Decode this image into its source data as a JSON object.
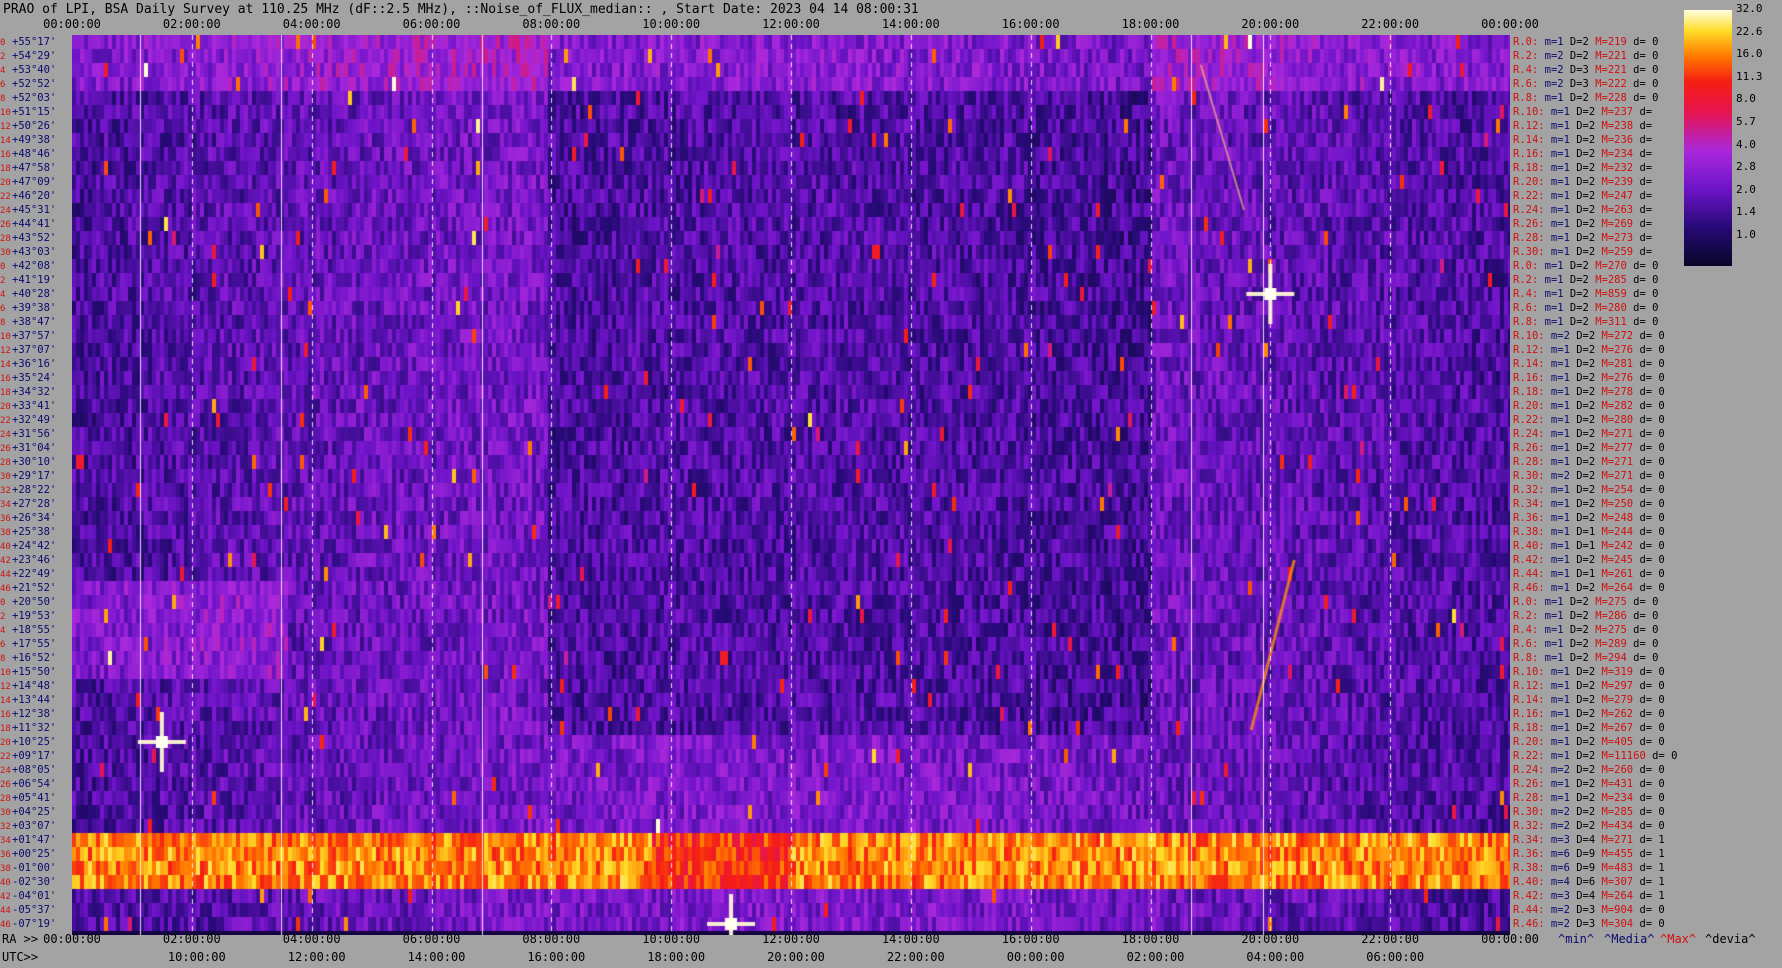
{
  "title": "PRAO of LPI, BSA Daily Survey at 110.25 MHz (dF::2.5 MHz), ::Noise_of_FLUX_median:: , Start Date: 2023 04 14 08:00:31",
  "top_axis_ticks": [
    "00:00:00",
    "02:00:00",
    "04:00:00",
    "06:00:00",
    "08:00:00",
    "10:00:00",
    "12:00:00",
    "14:00:00",
    "16:00:00",
    "18:00:00",
    "20:00:00",
    "22:00:00",
    "00:00:00"
  ],
  "bottom_ra_label": "RA >>",
  "bottom_utc_label": "UTC>>",
  "bottom_ra_ticks": [
    "00:00:00",
    "02:00:00",
    "04:00:00",
    "06:00:00",
    "08:00:00",
    "10:00:00",
    "12:00:00",
    "14:00:00",
    "16:00:00",
    "18:00:00",
    "20:00:00",
    "22:00:00",
    "00:00:00"
  ],
  "bottom_utc_ticks": [
    "10:00:00",
    "12:00:00",
    "14:00:00",
    "16:00:00",
    "18:00:00",
    "20:00:00",
    "22:00:00",
    "00:00:00",
    "02:00:00",
    "04:00:00",
    "06:00:00"
  ],
  "legend": {
    "min": "^min^",
    "median": "^Media^",
    "max": "^Max^",
    "devia": "^devia^"
  },
  "colorbar": {
    "ticks": [
      "32.0",
      "22.6",
      "16.0",
      "11.3",
      "8.0",
      "5.7",
      "4.0",
      "2.8",
      "2.0",
      "1.4",
      "1.0"
    ]
  },
  "colors": {
    "background": "#a3a3a3",
    "index_label": "#d01010",
    "declination_label": "#0a0a70",
    "max_label": "#d01010"
  },
  "chart_data": {
    "type": "heatmap",
    "title": "PRAO of LPI, BSA Daily Survey at 110.25 MHz (dF::2.5 MHz), ::Noise_of_FLUX_median:: , Start Date: 2023 04 14 08:00:31",
    "x_unit": "RA (hh:mm:ss)",
    "xlim": [
      "00:00:00",
      "24:00:00"
    ],
    "y_unit": "declination",
    "color_scale": "log",
    "zlim": [
      1.0,
      32.0
    ],
    "rows": [
      {
        "idx": "0",
        "dec": "+55°17'",
        "stat": {
          "r": "R.0:",
          "m": "m=1",
          "d": "D=2",
          "max": "M=219",
          "dev": "d= 0"
        }
      },
      {
        "idx": "2",
        "dec": "+54°29'",
        "stat": {
          "r": "R.2:",
          "m": "m=2",
          "d": "D=2",
          "max": "M=221",
          "dev": "d= 0"
        }
      },
      {
        "idx": "4",
        "dec": "+53°40'",
        "stat": {
          "r": "R.4:",
          "m": "m=2",
          "d": "D=3",
          "max": "M=221",
          "dev": "d= 0"
        }
      },
      {
        "idx": "6",
        "dec": "+52°52'",
        "stat": {
          "r": "R.6:",
          "m": "m=2",
          "d": "D=3",
          "max": "M=222",
          "dev": "d= 0"
        }
      },
      {
        "idx": "8",
        "dec": "+52°03'",
        "stat": {
          "r": "R.8:",
          "m": "m=1",
          "d": "D=2",
          "max": "M=228",
          "dev": "d= 0"
        }
      },
      {
        "idx": "10",
        "dec": "+51°15'",
        "stat": {
          "r": "R.10:",
          "m": "m=1",
          "d": "D=2",
          "max": "M=237",
          "dev": "d="
        }
      },
      {
        "idx": "12",
        "dec": "+50°26'",
        "stat": {
          "r": "R.12:",
          "m": "m=1",
          "d": "D=2",
          "max": "M=238",
          "dev": "d="
        }
      },
      {
        "idx": "14",
        "dec": "+49°38'",
        "stat": {
          "r": "R.14:",
          "m": "m=1",
          "d": "D=2",
          "max": "M=236",
          "dev": "d="
        }
      },
      {
        "idx": "16",
        "dec": "+48°46'",
        "stat": {
          "r": "R.16:",
          "m": "m=1",
          "d": "D=2",
          "max": "M=234",
          "dev": "d="
        }
      },
      {
        "idx": "18",
        "dec": "+47°58'",
        "stat": {
          "r": "R.18:",
          "m": "m=1",
          "d": "D=2",
          "max": "M=232",
          "dev": "d="
        }
      },
      {
        "idx": "20",
        "dec": "+47°09'",
        "stat": {
          "r": "R.20:",
          "m": "m=1",
          "d": "D=2",
          "max": "M=239",
          "dev": "d="
        }
      },
      {
        "idx": "22",
        "dec": "+46°20'",
        "stat": {
          "r": "R.22:",
          "m": "m=1",
          "d": "D=2",
          "max": "M=247",
          "dev": "d="
        }
      },
      {
        "idx": "24",
        "dec": "+45°31'",
        "stat": {
          "r": "R.24:",
          "m": "m=1",
          "d": "D=2",
          "max": "M=263",
          "dev": "d="
        }
      },
      {
        "idx": "26",
        "dec": "+44°41'",
        "stat": {
          "r": "R.26:",
          "m": "m=1",
          "d": "D=2",
          "max": "M=269",
          "dev": "d="
        }
      },
      {
        "idx": "28",
        "dec": "+43°52'",
        "stat": {
          "r": "R.28:",
          "m": "m=1",
          "d": "D=2",
          "max": "M=273",
          "dev": "d="
        }
      },
      {
        "idx": "30",
        "dec": "+43°03'",
        "stat": {
          "r": "R.30:",
          "m": "m=1",
          "d": "D=2",
          "max": "M=259",
          "dev": "d="
        }
      },
      {
        "idx": "0",
        "dec": "+42°08'",
        "stat": {
          "r": "R.0:",
          "m": "m=1",
          "d": "D=2",
          "max": "M=270",
          "dev": "d= 0"
        }
      },
      {
        "idx": "2",
        "dec": "+41°19'",
        "stat": {
          "r": "R.2:",
          "m": "m=1",
          "d": "D=2",
          "max": "M=285",
          "dev": "d= 0"
        }
      },
      {
        "idx": "4",
        "dec": "+40°28'",
        "stat": {
          "r": "R.4:",
          "m": "m=1",
          "d": "D=2",
          "max": "M=859",
          "dev": "d= 0"
        }
      },
      {
        "idx": "6",
        "dec": "+39°38'",
        "stat": {
          "r": "R.6:",
          "m": "m=1",
          "d": "D=2",
          "max": "M=280",
          "dev": "d= 0"
        }
      },
      {
        "idx": "8",
        "dec": "+38°47'",
        "stat": {
          "r": "R.8:",
          "m": "m=1",
          "d": "D=2",
          "max": "M=311",
          "dev": "d= 0"
        }
      },
      {
        "idx": "10",
        "dec": "+37°57'",
        "stat": {
          "r": "R.10:",
          "m": "m=2",
          "d": "D=2",
          "max": "M=272",
          "dev": "d= 0"
        }
      },
      {
        "idx": "12",
        "dec": "+37°07'",
        "stat": {
          "r": "R.12:",
          "m": "m=1",
          "d": "D=2",
          "max": "M=276",
          "dev": "d= 0"
        }
      },
      {
        "idx": "14",
        "dec": "+36°16'",
        "stat": {
          "r": "R.14:",
          "m": "m=1",
          "d": "D=2",
          "max": "M=281",
          "dev": "d= 0"
        }
      },
      {
        "idx": "16",
        "dec": "+35°24'",
        "stat": {
          "r": "R.16:",
          "m": "m=1",
          "d": "D=2",
          "max": "M=276",
          "dev": "d= 0"
        }
      },
      {
        "idx": "18",
        "dec": "+34°32'",
        "stat": {
          "r": "R.18:",
          "m": "m=1",
          "d": "D=2",
          "max": "M=278",
          "dev": "d= 0"
        }
      },
      {
        "idx": "20",
        "dec": "+33°41'",
        "stat": {
          "r": "R.20:",
          "m": "m=1",
          "d": "D=2",
          "max": "M=282",
          "dev": "d= 0"
        }
      },
      {
        "idx": "22",
        "dec": "+32°49'",
        "stat": {
          "r": "R.22:",
          "m": "m=1",
          "d": "D=2",
          "max": "M=280",
          "dev": "d= 0"
        }
      },
      {
        "idx": "24",
        "dec": "+31°56'",
        "stat": {
          "r": "R.24:",
          "m": "m=1",
          "d": "D=2",
          "max": "M=271",
          "dev": "d= 0"
        }
      },
      {
        "idx": "26",
        "dec": "+31°04'",
        "stat": {
          "r": "R.26:",
          "m": "m=1",
          "d": "D=2",
          "max": "M=277",
          "dev": "d= 0"
        }
      },
      {
        "idx": "28",
        "dec": "+30°10'",
        "stat": {
          "r": "R.28:",
          "m": "m=1",
          "d": "D=2",
          "max": "M=271",
          "dev": "d= 0"
        }
      },
      {
        "idx": "30",
        "dec": "+29°17'",
        "stat": {
          "r": "R.30:",
          "m": "m=2",
          "d": "D=2",
          "max": "M=271",
          "dev": "d= 0"
        }
      },
      {
        "idx": "32",
        "dec": "+28°22'",
        "stat": {
          "r": "R.32:",
          "m": "m=1",
          "d": "D=2",
          "max": "M=254",
          "dev": "d= 0"
        }
      },
      {
        "idx": "34",
        "dec": "+27°28'",
        "stat": {
          "r": "R.34:",
          "m": "m=1",
          "d": "D=2",
          "max": "M=250",
          "dev": "d= 0"
        }
      },
      {
        "idx": "36",
        "dec": "+26°34'",
        "stat": {
          "r": "R.36:",
          "m": "m=1",
          "d": "D=2",
          "max": "M=248",
          "dev": "d= 0"
        }
      },
      {
        "idx": "38",
        "dec": "+25°38'",
        "stat": {
          "r": "R.38:",
          "m": "m=1",
          "d": "D=1",
          "max": "M=244",
          "dev": "d= 0"
        }
      },
      {
        "idx": "40",
        "dec": "+24°42'",
        "stat": {
          "r": "R.40:",
          "m": "m=1",
          "d": "D=1",
          "max": "M=242",
          "dev": "d= 0"
        }
      },
      {
        "idx": "42",
        "dec": "+23°46'",
        "stat": {
          "r": "R.42:",
          "m": "m=1",
          "d": "D=2",
          "max": "M=245",
          "dev": "d= 0"
        }
      },
      {
        "idx": "44",
        "dec": "+22°49'",
        "stat": {
          "r": "R.44:",
          "m": "m=1",
          "d": "D=1",
          "max": "M=261",
          "dev": "d= 0"
        }
      },
      {
        "idx": "46",
        "dec": "+21°52'",
        "stat": {
          "r": "R.46:",
          "m": "m=1",
          "d": "D=2",
          "max": "M=264",
          "dev": "d= 0"
        }
      },
      {
        "idx": "0",
        "dec": "+20°50'",
        "stat": {
          "r": "R.0:",
          "m": "m=1",
          "d": "D=2",
          "max": "M=275",
          "dev": "d= 0"
        }
      },
      {
        "idx": "2",
        "dec": "+19°53'",
        "stat": {
          "r": "R.2:",
          "m": "m=1",
          "d": "D=2",
          "max": "M=286",
          "dev": "d= 0"
        }
      },
      {
        "idx": "4",
        "dec": "+18°55'",
        "stat": {
          "r": "R.4:",
          "m": "m=1",
          "d": "D=2",
          "max": "M=275",
          "dev": "d= 0"
        }
      },
      {
        "idx": "6",
        "dec": "+17°55'",
        "stat": {
          "r": "R.6:",
          "m": "m=1",
          "d": "D=2",
          "max": "M=289",
          "dev": "d= 0"
        }
      },
      {
        "idx": "8",
        "dec": "+16°52'",
        "stat": {
          "r": "R.8:",
          "m": "m=1",
          "d": "D=2",
          "max": "M=294",
          "dev": "d= 0"
        }
      },
      {
        "idx": "10",
        "dec": "+15°50'",
        "stat": {
          "r": "R.10:",
          "m": "m=1",
          "d": "D=2",
          "max": "M=319",
          "dev": "d= 0"
        }
      },
      {
        "idx": "12",
        "dec": "+14°48'",
        "stat": {
          "r": "R.12:",
          "m": "m=1",
          "d": "D=2",
          "max": "M=297",
          "dev": "d= 0"
        }
      },
      {
        "idx": "14",
        "dec": "+13°44'",
        "stat": {
          "r": "R.14:",
          "m": "m=1",
          "d": "D=2",
          "max": "M=279",
          "dev": "d= 0"
        }
      },
      {
        "idx": "16",
        "dec": "+12°38'",
        "stat": {
          "r": "R.16:",
          "m": "m=1",
          "d": "D=2",
          "max": "M=262",
          "dev": "d= 0"
        }
      },
      {
        "idx": "18",
        "dec": "+11°32'",
        "stat": {
          "r": "R.18:",
          "m": "m=1",
          "d": "D=2",
          "max": "M=267",
          "dev": "d= 0"
        }
      },
      {
        "idx": "20",
        "dec": "+10°25'",
        "stat": {
          "r": "R.20:",
          "m": "m=1",
          "d": "D=2",
          "max": "M=405",
          "dev": "d= 0"
        }
      },
      {
        "idx": "22",
        "dec": "+09°17'",
        "stat": {
          "r": "R.22:",
          "m": "m=1",
          "d": "D=2",
          "max": "M=11160",
          "dev": "d= 0"
        }
      },
      {
        "idx": "24",
        "dec": "+08°05'",
        "stat": {
          "r": "R.24:",
          "m": "m=2",
          "d": "D=2",
          "max": "M=260",
          "dev": "d= 0"
        }
      },
      {
        "idx": "26",
        "dec": "+06°54'",
        "stat": {
          "r": "R.26:",
          "m": "m=1",
          "d": "D=2",
          "max": "M=431",
          "dev": "d= 0"
        }
      },
      {
        "idx": "28",
        "dec": "+05°41'",
        "stat": {
          "r": "R.28:",
          "m": "m=1",
          "d": "D=2",
          "max": "M=234",
          "dev": "d= 0"
        }
      },
      {
        "idx": "30",
        "dec": "+04°25'",
        "stat": {
          "r": "R.30:",
          "m": "m=2",
          "d": "D=2",
          "max": "M=285",
          "dev": "d= 0"
        }
      },
      {
        "idx": "32",
        "dec": "+03°07'",
        "stat": {
          "r": "R.32:",
          "m": "m=2",
          "d": "D=2",
          "max": "M=434",
          "dev": "d= 0"
        }
      },
      {
        "idx": "34",
        "dec": "+01°47'",
        "stat": {
          "r": "R.34:",
          "m": "m=3",
          "d": "D=4",
          "max": "M=271",
          "dev": "d= 1"
        }
      },
      {
        "idx": "36",
        "dec": "+00°25'",
        "stat": {
          "r": "R.36:",
          "m": "m=6",
          "d": "D=9",
          "max": "M=455",
          "dev": "d= 1"
        }
      },
      {
        "idx": "38",
        "dec": "-01°00'",
        "stat": {
          "r": "R.38:",
          "m": "m=6",
          "d": "D=9",
          "max": "M=483",
          "dev": "d= 1"
        }
      },
      {
        "idx": "40",
        "dec": "-02°30'",
        "stat": {
          "r": "R.40:",
          "m": "m=4",
          "d": "D=6",
          "max": "M=307",
          "dev": "d= 1"
        }
      },
      {
        "idx": "42",
        "dec": "-04°01'",
        "stat": {
          "r": "R.42:",
          "m": "m=3",
          "d": "D=4",
          "max": "M=264",
          "dev": "d= 1"
        }
      },
      {
        "idx": "44",
        "dec": "-05°37'",
        "stat": {
          "r": "R.44:",
          "m": "m=2",
          "d": "D=3",
          "max": "M=904",
          "dev": "d= 0"
        }
      },
      {
        "idx": "46",
        "dec": "-07°19'",
        "stat": {
          "r": "R.46:",
          "m": "m=2",
          "d": "D=3",
          "max": "M=304",
          "dev": "d= 0"
        }
      }
    ],
    "bright_bands_dec": [
      "+01°47'",
      "+00°25'",
      "-01°00'",
      "-02°30'"
    ],
    "point_sources": [
      {
        "ra": "01:30:00",
        "dec": "+10°25'"
      },
      {
        "ra": "20:00:00",
        "dec": "+40°28'"
      },
      {
        "ra": "11:00:00",
        "dec": "-07°19'"
      }
    ]
  }
}
